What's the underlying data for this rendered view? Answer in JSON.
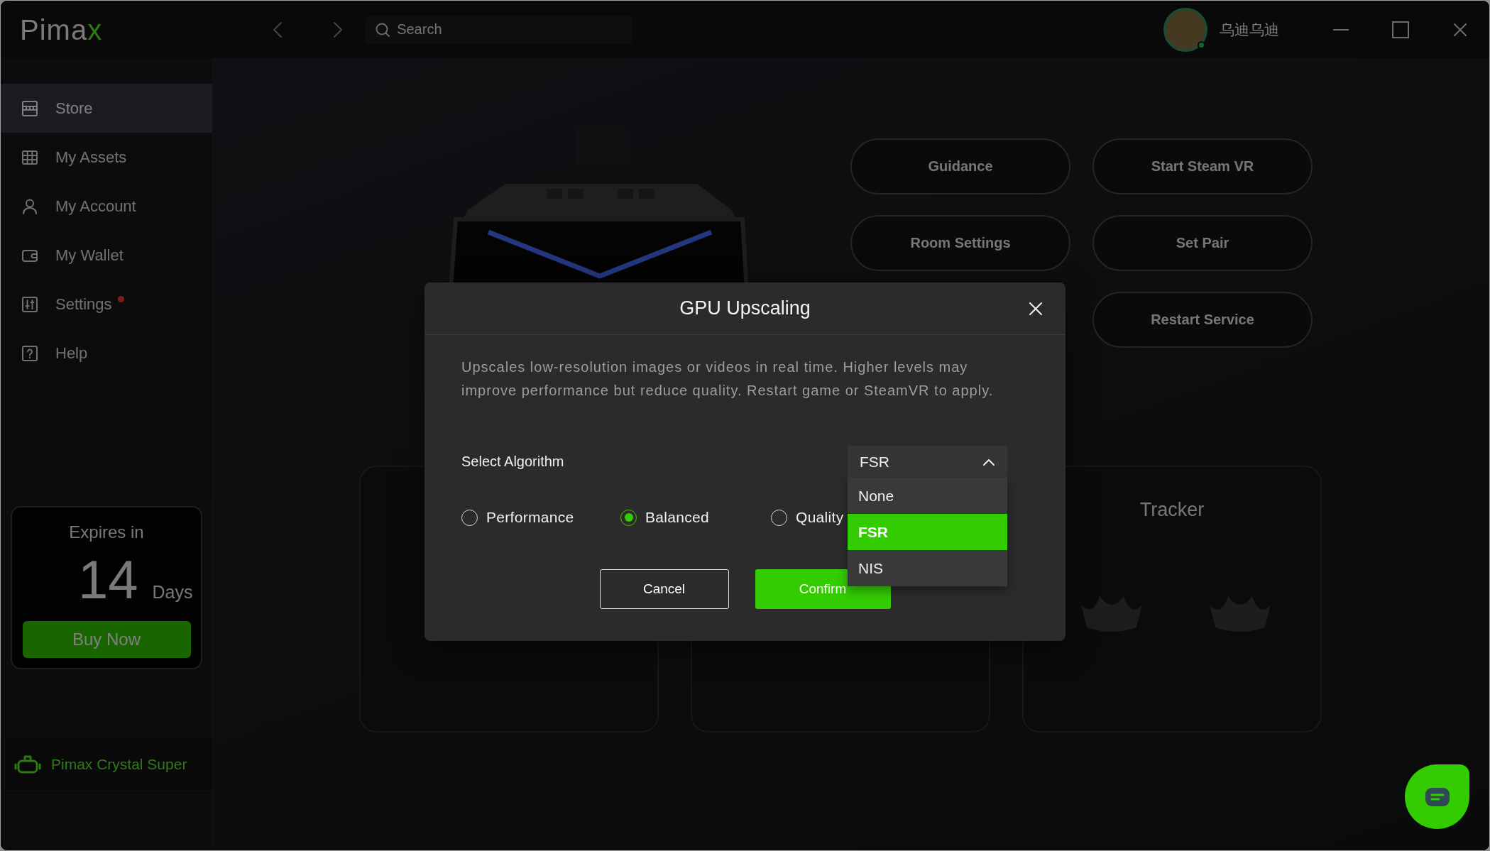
{
  "title_bar": {
    "logo": {
      "text": "Pima",
      "accent": "x"
    },
    "search": {
      "placeholder": "Search"
    },
    "user": {
      "name": "乌迪乌迪",
      "online": true
    }
  },
  "sidebar": {
    "items": [
      {
        "label": "Store",
        "selected": true,
        "badge": false
      },
      {
        "label": "My Assets",
        "selected": false,
        "badge": false
      },
      {
        "label": "My Account",
        "selected": false,
        "badge": false
      },
      {
        "label": "My Wallet",
        "selected": false,
        "badge": false
      },
      {
        "label": "Settings",
        "selected": false,
        "badge": true
      },
      {
        "label": "Help",
        "selected": false,
        "badge": false
      }
    ],
    "trial": {
      "title": "Expires in",
      "count": "14",
      "unit": "Days",
      "button": "Buy Now"
    },
    "device": {
      "name": "Pimax Crystal Super"
    }
  },
  "main": {
    "actions": {
      "left": [
        "Guidance",
        "Room Settings"
      ],
      "right": [
        "Start Steam VR",
        "Set Pair",
        "Restart Service"
      ]
    },
    "tracker_card": {
      "title": "Tracker"
    }
  },
  "dialog": {
    "title": "GPU Upscaling",
    "description": "Upscales low-resolution images or videos in real time. Higher levels may improve performance but reduce quality. Restart game or SteamVR to apply.",
    "field_label": "Select Algorithm",
    "select": {
      "value": "FSR",
      "expanded": true,
      "options": [
        {
          "label": "None",
          "selected": false
        },
        {
          "label": "FSR",
          "selected": true
        },
        {
          "label": "NIS",
          "selected": false
        }
      ]
    },
    "levels": [
      {
        "label": "Performance",
        "selected": false
      },
      {
        "label": "Balanced",
        "selected": true
      },
      {
        "label": "Quality",
        "selected": false
      }
    ],
    "buttons": [
      {
        "label": "Cancel",
        "kind": "cancel"
      },
      {
        "label": "Confirm",
        "kind": "confirm"
      }
    ]
  }
}
